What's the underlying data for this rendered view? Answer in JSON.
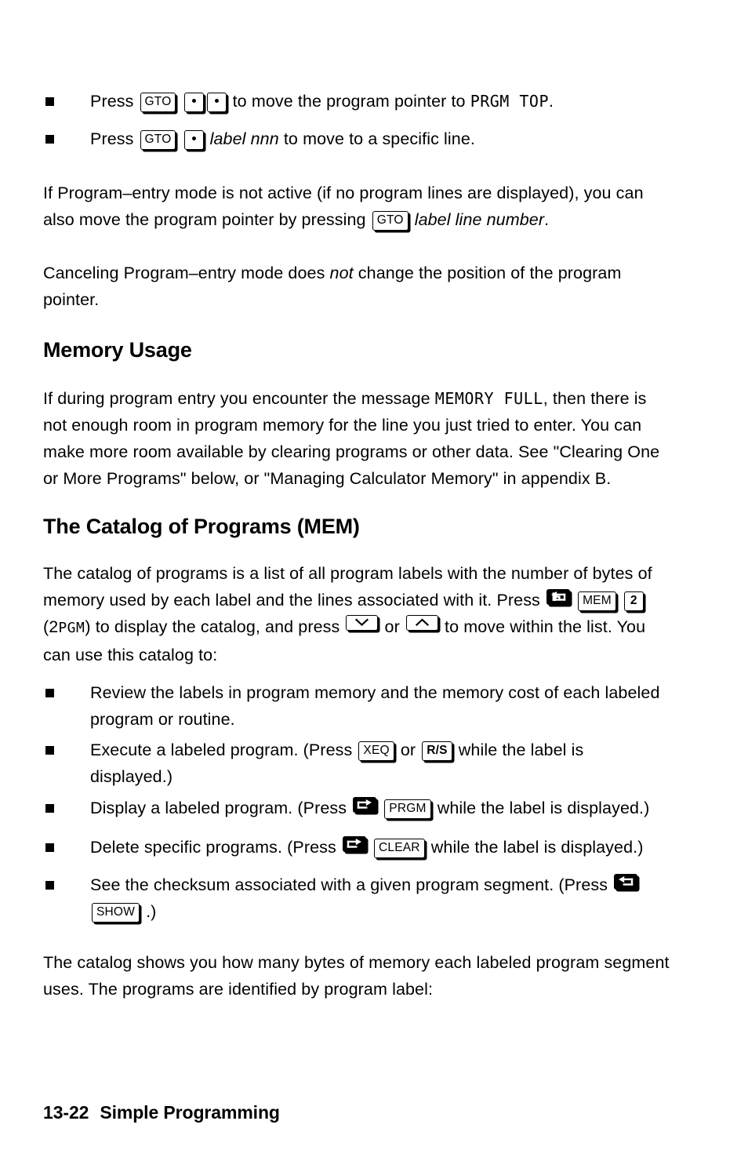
{
  "document": {
    "bullets_top": [
      {
        "id": "gto-prgm-top",
        "press_label": "Press",
        "key1": "GTO",
        "key2": "dot",
        "key3": "dot",
        "text_after": "to move the program pointer to",
        "lcd_text": "PRGM TOP",
        "tail": "."
      },
      {
        "id": "gto-label-nnn",
        "press_label": "Press",
        "key1": "GTO",
        "key2": "dot",
        "italic_text": "label nnn",
        "text_after": "to move to a specific line."
      }
    ],
    "para_program_entry": {
      "line1": "If Program–entry mode is not active (if no program lines are displayed), you can",
      "line2_before": "also move the program pointer by pressing",
      "key": "GTO",
      "line2_italic": "label line number",
      "line2_after": "."
    },
    "para_canceling": {
      "before_italic": "Canceling Program–entry mode does",
      "italic": "not",
      "after_italic": "change the position of the program pointer."
    },
    "heading_memory_usage": "Memory Usage",
    "para_memory_full": {
      "before_lcd": "If during program entry you encounter the message",
      "lcd": "MEMORY FULL",
      "after_lcd": ", then there is not enough room in program memory for the line you just tried to enter. You can make more room available by clearing programs or other data. See \"Clearing One or More Programs\" below, or \"Managing Calculator Memory\" in appendix B."
    },
    "heading_catalog": "The Catalog of Programs (MEM)",
    "para_catalog": {
      "seg1": "The catalog of programs is a list of all program labels with the number of bytes of memory used by each label and the lines associated with it. Press",
      "shift_left_key": "left-shift-key",
      "key_mem": "MEM",
      "key_2": "2",
      "seg2_open": "(2",
      "lcd_pgm": "PGM",
      "seg2_close": ")",
      "seg3": "to display the catalog, and press",
      "key_down": "chevron-down",
      "or_text": "or",
      "key_up": "chevron-up",
      "seg4": "to move within the list. You can use this catalog to:"
    },
    "bullets_catalog": [
      {
        "id": "review-labels",
        "text": "Review the labels in program memory and the memory cost of each labeled program or routine."
      },
      {
        "id": "execute-labeled-program",
        "seg1": "Execute a labeled program. (Press",
        "key1": "XEQ",
        "or_text": "or",
        "key2": "R/S",
        "seg2": "while the label is displayed.)"
      },
      {
        "id": "display-labeled-program",
        "seg1": "Display a labeled program. (Press",
        "shift_key": "right-shift-key",
        "key1": "PRGM",
        "seg2": "while the label is displayed.)"
      },
      {
        "id": "delete-specific-programs",
        "seg1": "Delete specific programs. (Press",
        "shift_key": "right-shift-key",
        "key1": "CLEAR",
        "seg2": "while the label is displayed.)"
      },
      {
        "id": "see-checksum",
        "seg1": "See the checksum associated with a given program segment. (Press",
        "shift_key": "left-shift-key",
        "key1": "SHOW",
        "seg2": ".)"
      }
    ],
    "para_catalog_bytes": "The catalog shows you how many bytes of memory each labeled program segment uses. The programs are identified by program label:",
    "footer": {
      "page_number": "13-22",
      "chapter_title": "Simple Programming"
    }
  }
}
